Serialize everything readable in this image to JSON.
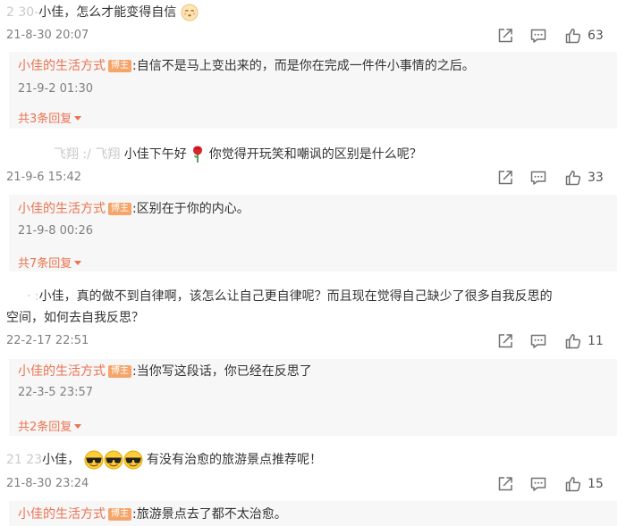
{
  "comments": [
    {
      "prefix": "2    30-",
      "text": "小佳，怎么才能变得自信",
      "time": "21-8-30 20:07",
      "likes": "63",
      "reply": {
        "author": "小佳的生活方式",
        "badge": "博主",
        "text": ":自信不是马上变出来的，而是你在完成一件件小事情的之后。",
        "time": "21-9-2 01:30"
      },
      "more": "共3条回复"
    },
    {
      "prefix": "飞翔 :/  飞翔 ",
      "text": "小佳下午好",
      "text_after": "你觉得开玩笑和嘲讽的区别是什么呢？",
      "time": "21-9-6 15:42",
      "likes": "33",
      "reply": {
        "author": "小佳的生活方式",
        "badge": "博主",
        "text": ":区别在于你的内心。",
        "time": "21-9-8 00:26"
      },
      "more": "共7条回复"
    },
    {
      "prefix": "·  :",
      "text": "小佳，真的做不到自律啊，该怎么让自己更自律呢？而且现在觉得自己缺少了很多自我反思的",
      "text_line2": "空间，如何去自我反思？",
      "time": "22-2-17 22:51",
      "likes": "11",
      "reply": {
        "author": "小佳的生活方式",
        "badge": "博主",
        "text": ":当你写这段话，你已经在反思了",
        "time": "22-3-5 23:57"
      },
      "more": "共2条回复"
    },
    {
      "prefix": "21              23",
      "text": "小佳，",
      "text_after": "有没有治愈的旅游景点推荐呢！",
      "time": "21-8-30 23:24",
      "likes": "15",
      "reply": {
        "author": "小佳的生活方式",
        "badge": "博主",
        "text": ":旅游景点去了都不太治愈。"
      }
    }
  ],
  "icons": {
    "share": "share-icon",
    "comment": "comment-icon",
    "like": "thumbs-up-icon"
  },
  "colors": {
    "author": "#eb7350",
    "badge": "#f5a56b",
    "reply_bg": "#f7f7f7"
  }
}
